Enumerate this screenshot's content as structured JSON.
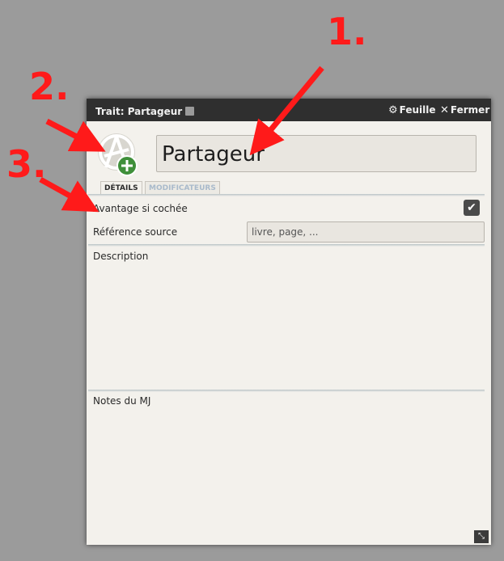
{
  "annotations": {
    "a1": "1.",
    "a2": "2.",
    "a3": "3."
  },
  "window": {
    "title": "Trait: Partageur",
    "sheet_label": "Feuille",
    "close_label": "Fermer"
  },
  "name": "Partageur",
  "tabs": {
    "details": "DÉTAILS",
    "modifiers": "MODIFICATEURS"
  },
  "fields": {
    "advantage_label": "Avantage si cochée",
    "advantage_checked": true,
    "source_label": "Référence source",
    "source_placeholder": "livre, page, ...",
    "description_label": "Description",
    "gm_notes_label": "Notes du MJ"
  },
  "colors": {
    "annotation": "#ff1a1a",
    "titlebar": "#2f2f2f",
    "sheet_bg": "#f3f1ec"
  },
  "icons": [
    "gear-icon",
    "close-icon",
    "anarchy-plus-icon",
    "check-icon",
    "resize-icon"
  ]
}
